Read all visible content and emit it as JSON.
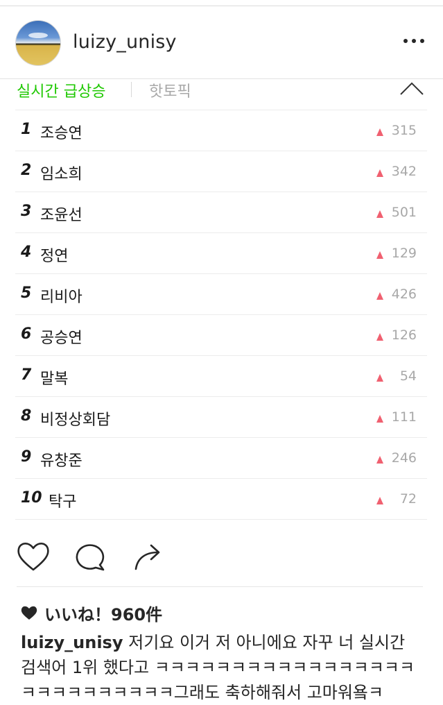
{
  "post": {
    "username": "luizy_unisy",
    "avatar_icon": "avatar-image",
    "more_icon": "more-options-icon"
  },
  "ranking": {
    "tabs": {
      "active": "실시간 급상승",
      "inactive": "핫토픽"
    },
    "collapse_icon": "chevron-up-icon",
    "up_color": "#f06070",
    "accent_color": "#1ec800",
    "items": [
      {
        "rank": "1",
        "keyword": "조승연",
        "change": "315"
      },
      {
        "rank": "2",
        "keyword": "임소희",
        "change": "342"
      },
      {
        "rank": "3",
        "keyword": "조윤선",
        "change": "501"
      },
      {
        "rank": "4",
        "keyword": "정연",
        "change": "129"
      },
      {
        "rank": "5",
        "keyword": "리비아",
        "change": "426"
      },
      {
        "rank": "6",
        "keyword": "공승연",
        "change": "126"
      },
      {
        "rank": "7",
        "keyword": "말복",
        "change": "54"
      },
      {
        "rank": "8",
        "keyword": "비정상회담",
        "change": "111"
      },
      {
        "rank": "9",
        "keyword": "유창준",
        "change": "246"
      },
      {
        "rank": "10",
        "keyword": "탁구",
        "change": "72"
      }
    ]
  },
  "actions": {
    "like_icon": "heart-icon",
    "comment_icon": "comment-icon",
    "share_icon": "share-icon"
  },
  "likes": {
    "text": "いいね！960件"
  },
  "caption": {
    "username": "luizy_unisy",
    "text": " 저기요 이거 저 아니에요 자꾸 너 실시간 검색어 1위 했다고 ㅋㅋㅋㅋㅋㅋㅋㅋㅋㅋㅋㅋㅋㅋㅋㅋㅋㅋㅋㅋㅋㅋㅋㅋㅋㅋㅋ그래도 축하해줘서 고마워욬ㅋ"
  }
}
